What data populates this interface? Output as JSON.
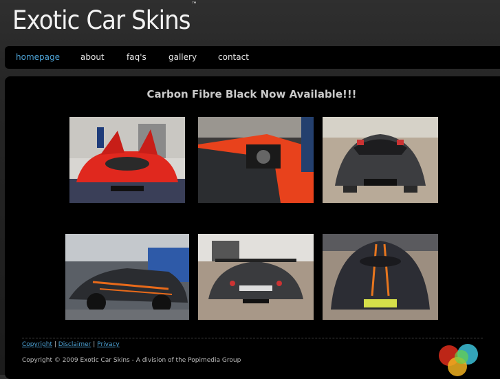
{
  "header": {
    "logo_text": "Exotic Car Skins",
    "trademark": "™"
  },
  "nav": {
    "items": [
      {
        "label": "homepage",
        "active": true
      },
      {
        "label": "about",
        "active": false
      },
      {
        "label": "faq's",
        "active": false
      },
      {
        "label": "gallery",
        "active": false
      },
      {
        "label": "contact",
        "active": false
      }
    ]
  },
  "main": {
    "headline": "Carbon Fibre Black Now Available!!!",
    "photos": [
      {
        "name": "gallery-photo-red-ferrari-doors"
      },
      {
        "name": "gallery-photo-ferrari-wrap-half"
      },
      {
        "name": "gallery-photo-black-ferrari-front"
      },
      {
        "name": "gallery-photo-black-racer-side"
      },
      {
        "name": "gallery-photo-black-ferrari-rear"
      },
      {
        "name": "gallery-photo-black-stripe-front"
      }
    ]
  },
  "footer": {
    "links": [
      "Copyright",
      "Disclaimer",
      "Privacy"
    ],
    "separator": "|",
    "copyright": "Copyright ©  2009 Exotic Car Skins - A division of the Popimedia Group"
  },
  "colors": {
    "accent": "#4da3d6",
    "background": "#000000"
  }
}
